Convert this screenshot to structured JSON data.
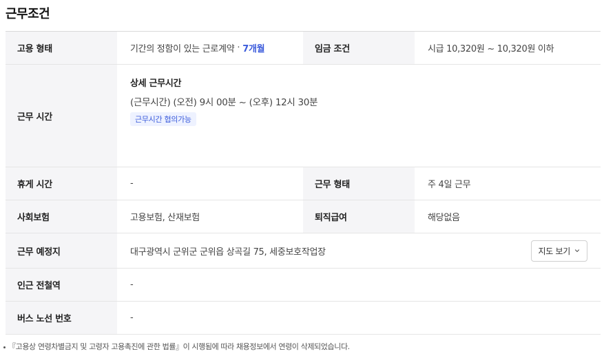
{
  "section_title": "근무조건",
  "rows": {
    "employment": {
      "label": "고용 형태",
      "value": "기간의 정함이 있는 근로계약",
      "separator": "·",
      "period": "7개월",
      "wage_label": "임금 조건",
      "wage_value": "시급 10,320원 ~ 10,320원 이하"
    },
    "hours": {
      "label": "근무 시간",
      "detail_title": "상세 근무시간",
      "detail_text": "(근무시간) (오전) 9시 00분 ~ (오후) 12시 30분",
      "badge": "근무시간 협의가능"
    },
    "break": {
      "label": "휴게 시간",
      "value": "-",
      "type_label": "근무 형태",
      "type_value": "주 4일 근무"
    },
    "insurance": {
      "label": "사회보험",
      "value": "고용보험, 산재보험",
      "severance_label": "퇴직급여",
      "severance_value": "해당없음"
    },
    "location": {
      "label": "근무 예정지",
      "value": "대구광역시 군위군 군위읍 상곡길 75, 세중보호작업장",
      "map_button": "지도 보기"
    },
    "subway": {
      "label": "인근 전철역",
      "value": "-"
    },
    "bus": {
      "label": "버스 노선 번호",
      "value": "-"
    }
  },
  "footnote": "『고용상 연령차별금지 및 고령자 고용촉진에 관한 법률』이 시행됨에 따라 채용정보에서 연령이 삭제되었습니다.",
  "colors": {
    "accent": "#3b5bdb",
    "header_bg": "#f5f5f7",
    "badge_bg": "#eef2ff"
  }
}
